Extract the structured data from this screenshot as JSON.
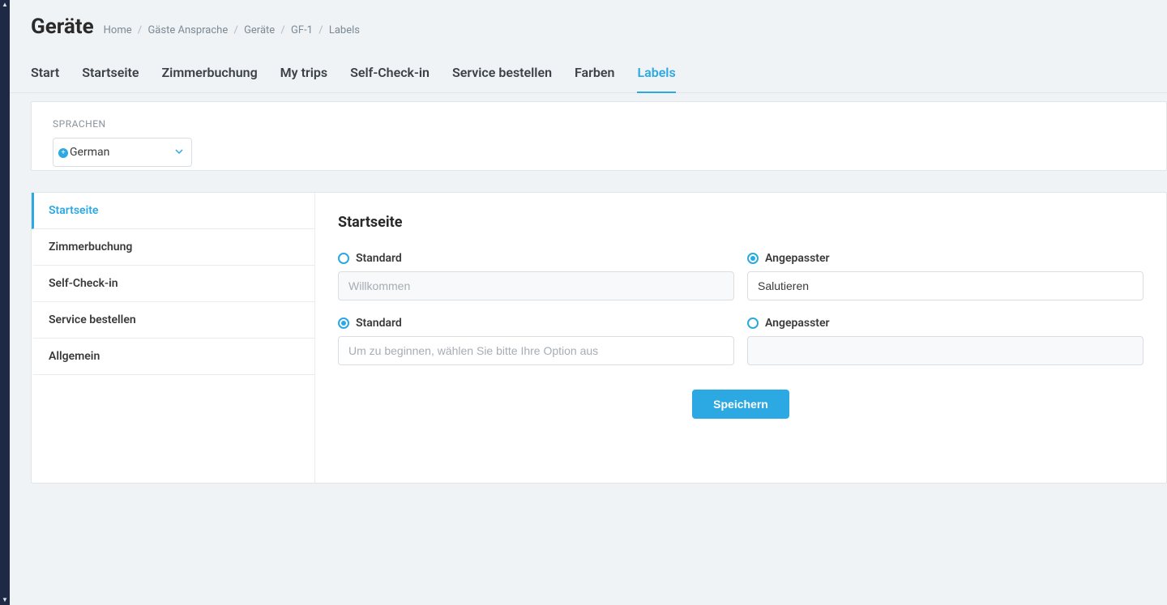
{
  "header": {
    "title": "Geräte",
    "breadcrumb": {
      "home": "Home",
      "guest_outreach": "Gäste Ansprache",
      "devices": "Geräte",
      "device_id": "GF-1",
      "current": "Labels"
    }
  },
  "top_tabs": [
    {
      "label": "Start",
      "active": false
    },
    {
      "label": "Startseite",
      "active": false
    },
    {
      "label": "Zimmerbuchung",
      "active": false
    },
    {
      "label": "My trips",
      "active": false
    },
    {
      "label": "Self-Check-in",
      "active": false
    },
    {
      "label": "Service bestellen",
      "active": false
    },
    {
      "label": "Farben",
      "active": false
    },
    {
      "label": "Labels",
      "active": true
    }
  ],
  "language": {
    "section_label": "SPRACHEN",
    "selected": "German"
  },
  "side_nav": [
    {
      "label": "Startseite",
      "active": true
    },
    {
      "label": "Zimmerbuchung",
      "active": false
    },
    {
      "label": "Self-Check-in",
      "active": false
    },
    {
      "label": "Service bestellen",
      "active": false
    },
    {
      "label": "Allgemein",
      "active": false
    }
  ],
  "form": {
    "section_title": "Startseite",
    "radio_standard": "Standard",
    "radio_custom": "Angepasster",
    "rows": [
      {
        "mode": "custom",
        "standard_placeholder": "Willkommen",
        "standard_value": "",
        "custom_value": "Salutieren"
      },
      {
        "mode": "standard",
        "standard_placeholder": "Um zu beginnen, wählen Sie bitte Ihre Option aus",
        "standard_value": "",
        "custom_value": ""
      }
    ],
    "save_label": "Speichern"
  }
}
